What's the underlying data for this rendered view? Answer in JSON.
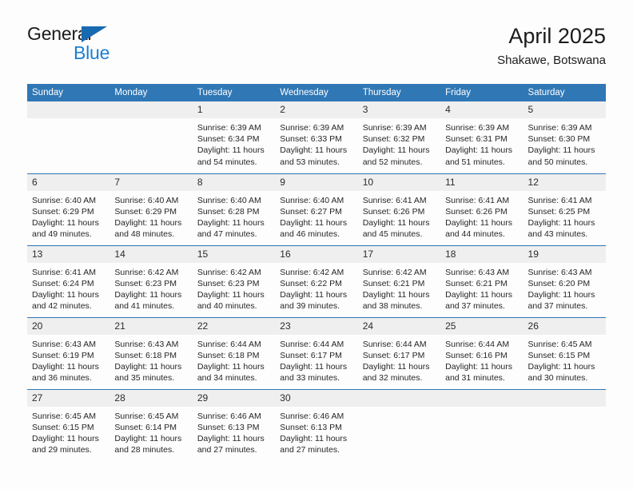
{
  "brand": {
    "name_top": "General",
    "name_bottom": "Blue",
    "triangle_color": "#1769b0",
    "blue_text_color": "#1b7fd4"
  },
  "header": {
    "title": "April 2025",
    "subtitle": "Shakawe, Botswana"
  },
  "colors": {
    "header_bar": "#3077b5",
    "row_divider": "#2f76b4",
    "day_band": "#efefef",
    "page_background": "#fdfdfd",
    "text": "#262626"
  },
  "weekday_headers": [
    "Sunday",
    "Monday",
    "Tuesday",
    "Wednesday",
    "Thursday",
    "Friday",
    "Saturday"
  ],
  "weeks": [
    [
      {
        "day": "",
        "empty": true,
        "sunrise": "",
        "sunset": "",
        "daylight_line1": "",
        "daylight_line2": ""
      },
      {
        "day": "",
        "empty": true,
        "sunrise": "",
        "sunset": "",
        "daylight_line1": "",
        "daylight_line2": ""
      },
      {
        "day": "1",
        "sunrise": "Sunrise: 6:39 AM",
        "sunset": "Sunset: 6:34 PM",
        "daylight_line1": "Daylight: 11 hours",
        "daylight_line2": "and 54 minutes."
      },
      {
        "day": "2",
        "sunrise": "Sunrise: 6:39 AM",
        "sunset": "Sunset: 6:33 PM",
        "daylight_line1": "Daylight: 11 hours",
        "daylight_line2": "and 53 minutes."
      },
      {
        "day": "3",
        "sunrise": "Sunrise: 6:39 AM",
        "sunset": "Sunset: 6:32 PM",
        "daylight_line1": "Daylight: 11 hours",
        "daylight_line2": "and 52 minutes."
      },
      {
        "day": "4",
        "sunrise": "Sunrise: 6:39 AM",
        "sunset": "Sunset: 6:31 PM",
        "daylight_line1": "Daylight: 11 hours",
        "daylight_line2": "and 51 minutes."
      },
      {
        "day": "5",
        "sunrise": "Sunrise: 6:39 AM",
        "sunset": "Sunset: 6:30 PM",
        "daylight_line1": "Daylight: 11 hours",
        "daylight_line2": "and 50 minutes."
      }
    ],
    [
      {
        "day": "6",
        "sunrise": "Sunrise: 6:40 AM",
        "sunset": "Sunset: 6:29 PM",
        "daylight_line1": "Daylight: 11 hours",
        "daylight_line2": "and 49 minutes."
      },
      {
        "day": "7",
        "sunrise": "Sunrise: 6:40 AM",
        "sunset": "Sunset: 6:29 PM",
        "daylight_line1": "Daylight: 11 hours",
        "daylight_line2": "and 48 minutes."
      },
      {
        "day": "8",
        "sunrise": "Sunrise: 6:40 AM",
        "sunset": "Sunset: 6:28 PM",
        "daylight_line1": "Daylight: 11 hours",
        "daylight_line2": "and 47 minutes."
      },
      {
        "day": "9",
        "sunrise": "Sunrise: 6:40 AM",
        "sunset": "Sunset: 6:27 PM",
        "daylight_line1": "Daylight: 11 hours",
        "daylight_line2": "and 46 minutes."
      },
      {
        "day": "10",
        "sunrise": "Sunrise: 6:41 AM",
        "sunset": "Sunset: 6:26 PM",
        "daylight_line1": "Daylight: 11 hours",
        "daylight_line2": "and 45 minutes."
      },
      {
        "day": "11",
        "sunrise": "Sunrise: 6:41 AM",
        "sunset": "Sunset: 6:26 PM",
        "daylight_line1": "Daylight: 11 hours",
        "daylight_line2": "and 44 minutes."
      },
      {
        "day": "12",
        "sunrise": "Sunrise: 6:41 AM",
        "sunset": "Sunset: 6:25 PM",
        "daylight_line1": "Daylight: 11 hours",
        "daylight_line2": "and 43 minutes."
      }
    ],
    [
      {
        "day": "13",
        "sunrise": "Sunrise: 6:41 AM",
        "sunset": "Sunset: 6:24 PM",
        "daylight_line1": "Daylight: 11 hours",
        "daylight_line2": "and 42 minutes."
      },
      {
        "day": "14",
        "sunrise": "Sunrise: 6:42 AM",
        "sunset": "Sunset: 6:23 PM",
        "daylight_line1": "Daylight: 11 hours",
        "daylight_line2": "and 41 minutes."
      },
      {
        "day": "15",
        "sunrise": "Sunrise: 6:42 AM",
        "sunset": "Sunset: 6:23 PM",
        "daylight_line1": "Daylight: 11 hours",
        "daylight_line2": "and 40 minutes."
      },
      {
        "day": "16",
        "sunrise": "Sunrise: 6:42 AM",
        "sunset": "Sunset: 6:22 PM",
        "daylight_line1": "Daylight: 11 hours",
        "daylight_line2": "and 39 minutes."
      },
      {
        "day": "17",
        "sunrise": "Sunrise: 6:42 AM",
        "sunset": "Sunset: 6:21 PM",
        "daylight_line1": "Daylight: 11 hours",
        "daylight_line2": "and 38 minutes."
      },
      {
        "day": "18",
        "sunrise": "Sunrise: 6:43 AM",
        "sunset": "Sunset: 6:21 PM",
        "daylight_line1": "Daylight: 11 hours",
        "daylight_line2": "and 37 minutes."
      },
      {
        "day": "19",
        "sunrise": "Sunrise: 6:43 AM",
        "sunset": "Sunset: 6:20 PM",
        "daylight_line1": "Daylight: 11 hours",
        "daylight_line2": "and 37 minutes."
      }
    ],
    [
      {
        "day": "20",
        "sunrise": "Sunrise: 6:43 AM",
        "sunset": "Sunset: 6:19 PM",
        "daylight_line1": "Daylight: 11 hours",
        "daylight_line2": "and 36 minutes."
      },
      {
        "day": "21",
        "sunrise": "Sunrise: 6:43 AM",
        "sunset": "Sunset: 6:18 PM",
        "daylight_line1": "Daylight: 11 hours",
        "daylight_line2": "and 35 minutes."
      },
      {
        "day": "22",
        "sunrise": "Sunrise: 6:44 AM",
        "sunset": "Sunset: 6:18 PM",
        "daylight_line1": "Daylight: 11 hours",
        "daylight_line2": "and 34 minutes."
      },
      {
        "day": "23",
        "sunrise": "Sunrise: 6:44 AM",
        "sunset": "Sunset: 6:17 PM",
        "daylight_line1": "Daylight: 11 hours",
        "daylight_line2": "and 33 minutes."
      },
      {
        "day": "24",
        "sunrise": "Sunrise: 6:44 AM",
        "sunset": "Sunset: 6:17 PM",
        "daylight_line1": "Daylight: 11 hours",
        "daylight_line2": "and 32 minutes."
      },
      {
        "day": "25",
        "sunrise": "Sunrise: 6:44 AM",
        "sunset": "Sunset: 6:16 PM",
        "daylight_line1": "Daylight: 11 hours",
        "daylight_line2": "and 31 minutes."
      },
      {
        "day": "26",
        "sunrise": "Sunrise: 6:45 AM",
        "sunset": "Sunset: 6:15 PM",
        "daylight_line1": "Daylight: 11 hours",
        "daylight_line2": "and 30 minutes."
      }
    ],
    [
      {
        "day": "27",
        "sunrise": "Sunrise: 6:45 AM",
        "sunset": "Sunset: 6:15 PM",
        "daylight_line1": "Daylight: 11 hours",
        "daylight_line2": "and 29 minutes."
      },
      {
        "day": "28",
        "sunrise": "Sunrise: 6:45 AM",
        "sunset": "Sunset: 6:14 PM",
        "daylight_line1": "Daylight: 11 hours",
        "daylight_line2": "and 28 minutes."
      },
      {
        "day": "29",
        "sunrise": "Sunrise: 6:46 AM",
        "sunset": "Sunset: 6:13 PM",
        "daylight_line1": "Daylight: 11 hours",
        "daylight_line2": "and 27 minutes."
      },
      {
        "day": "30",
        "sunrise": "Sunrise: 6:46 AM",
        "sunset": "Sunset: 6:13 PM",
        "daylight_line1": "Daylight: 11 hours",
        "daylight_line2": "and 27 minutes."
      },
      {
        "day": "",
        "empty": true,
        "sunrise": "",
        "sunset": "",
        "daylight_line1": "",
        "daylight_line2": ""
      },
      {
        "day": "",
        "empty": true,
        "sunrise": "",
        "sunset": "",
        "daylight_line1": "",
        "daylight_line2": ""
      },
      {
        "day": "",
        "empty": true,
        "sunrise": "",
        "sunset": "",
        "daylight_line1": "",
        "daylight_line2": ""
      }
    ]
  ]
}
